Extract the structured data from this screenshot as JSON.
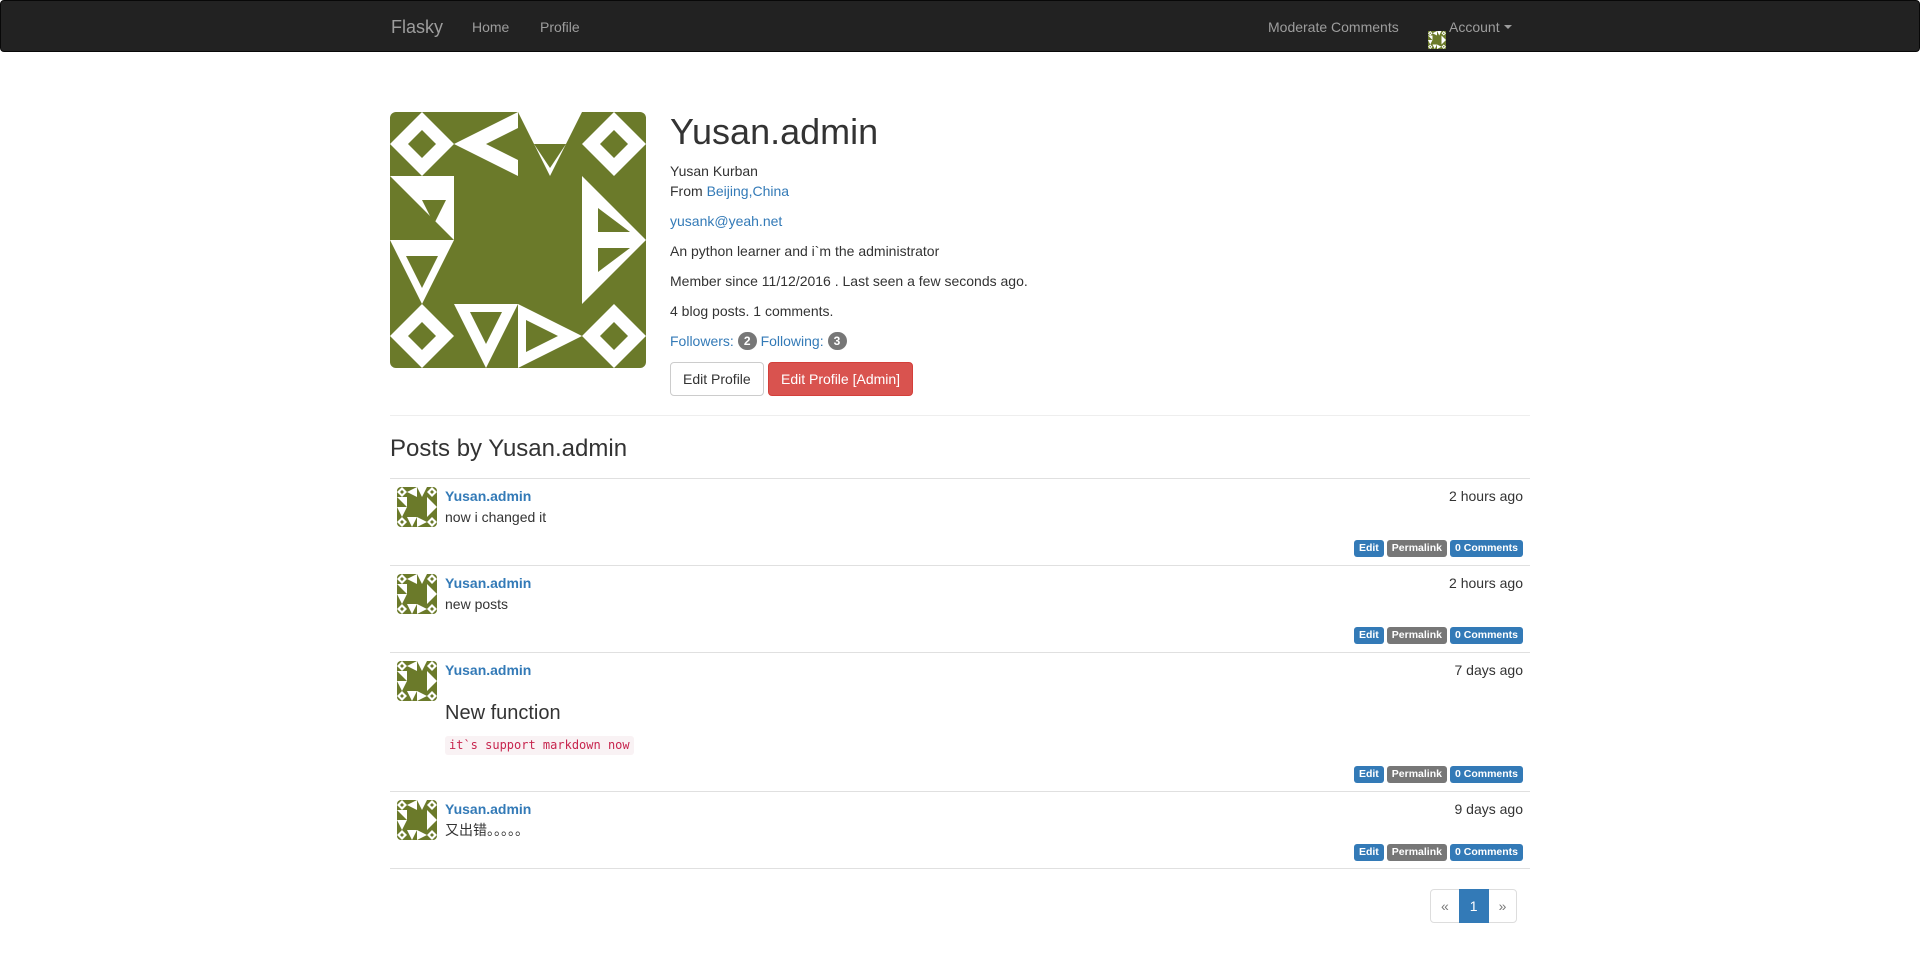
{
  "navbar": {
    "brand": "Flasky",
    "links": {
      "home": "Home",
      "profile": "Profile"
    },
    "moderate": "Moderate Comments",
    "account": "Account"
  },
  "profile": {
    "username": "Yusan.admin",
    "name": "Yusan Kurban",
    "from_prefix": "From ",
    "location": "Beijing,China",
    "email": "yusank@yeah.net",
    "about": "An python learner and i`m the administrator",
    "member_since": "Member since 11/12/2016 . Last seen a few seconds ago.",
    "stats": "4 blog posts. 1 comments.",
    "followers_label": "Followers:",
    "followers_count": "2",
    "following_label": "Following:",
    "following_count": "3",
    "edit_button": "Edit Profile",
    "edit_admin_button": "Edit Profile [Admin]",
    "avatar_color": "#6b7a2a"
  },
  "posts_title": "Posts by Yusan.admin",
  "posts": [
    {
      "author": "Yusan.admin",
      "date": "2 hours ago",
      "body": "now i changed it"
    },
    {
      "author": "Yusan.admin",
      "date": "2 hours ago",
      "body": "new posts"
    },
    {
      "author": "Yusan.admin",
      "date": "7 days ago",
      "heading": "New function",
      "code": "it`s support markdown now"
    },
    {
      "author": "Yusan.admin",
      "date": "9 days ago",
      "body": "又出错。。。。。"
    }
  ],
  "post_labels": {
    "edit": "Edit",
    "permalink": "Permalink",
    "comments": "0 Comments"
  },
  "pagination": {
    "prev": "«",
    "current": "1",
    "next": "»"
  }
}
